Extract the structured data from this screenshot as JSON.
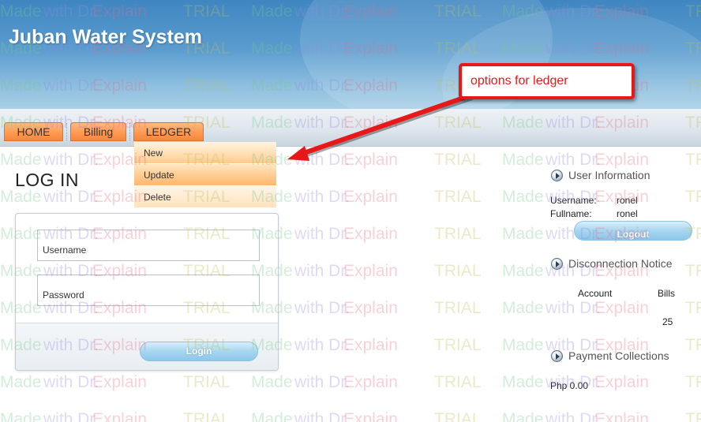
{
  "header": {
    "title": "Juban Water System"
  },
  "nav": {
    "tabs": [
      "HOME",
      "Billing",
      "LEDGER"
    ]
  },
  "ledger_menu": {
    "items": [
      "New",
      "Update",
      "Delete"
    ]
  },
  "login": {
    "title": "LOG IN",
    "username_placeholder": "Username",
    "password_placeholder": "Password",
    "button_label": "Login"
  },
  "sidebar": {
    "user_info": {
      "heading": "User Information",
      "username_label": "Username:",
      "username_value": "ronel",
      "fullname_label": "Fullname:",
      "fullname_value": "ronel",
      "logout_label": "Logout"
    },
    "disconnection": {
      "heading": "Disconnection Notice",
      "columns": [
        "Account",
        "Bills"
      ],
      "rows": [
        {
          "account": "",
          "bills": "25"
        }
      ]
    },
    "payments": {
      "heading": "Payment Collections",
      "total": "Php 0.00"
    }
  },
  "annotation": {
    "callout": "options for ledger"
  },
  "watermark": {
    "parts": [
      "Made",
      "with Dr.",
      "Explain",
      "TRIAL"
    ]
  },
  "colors": {
    "nav_orange": "#ff9a52",
    "callout_red": "#e81818",
    "header_blue": "#4a8fc8"
  }
}
